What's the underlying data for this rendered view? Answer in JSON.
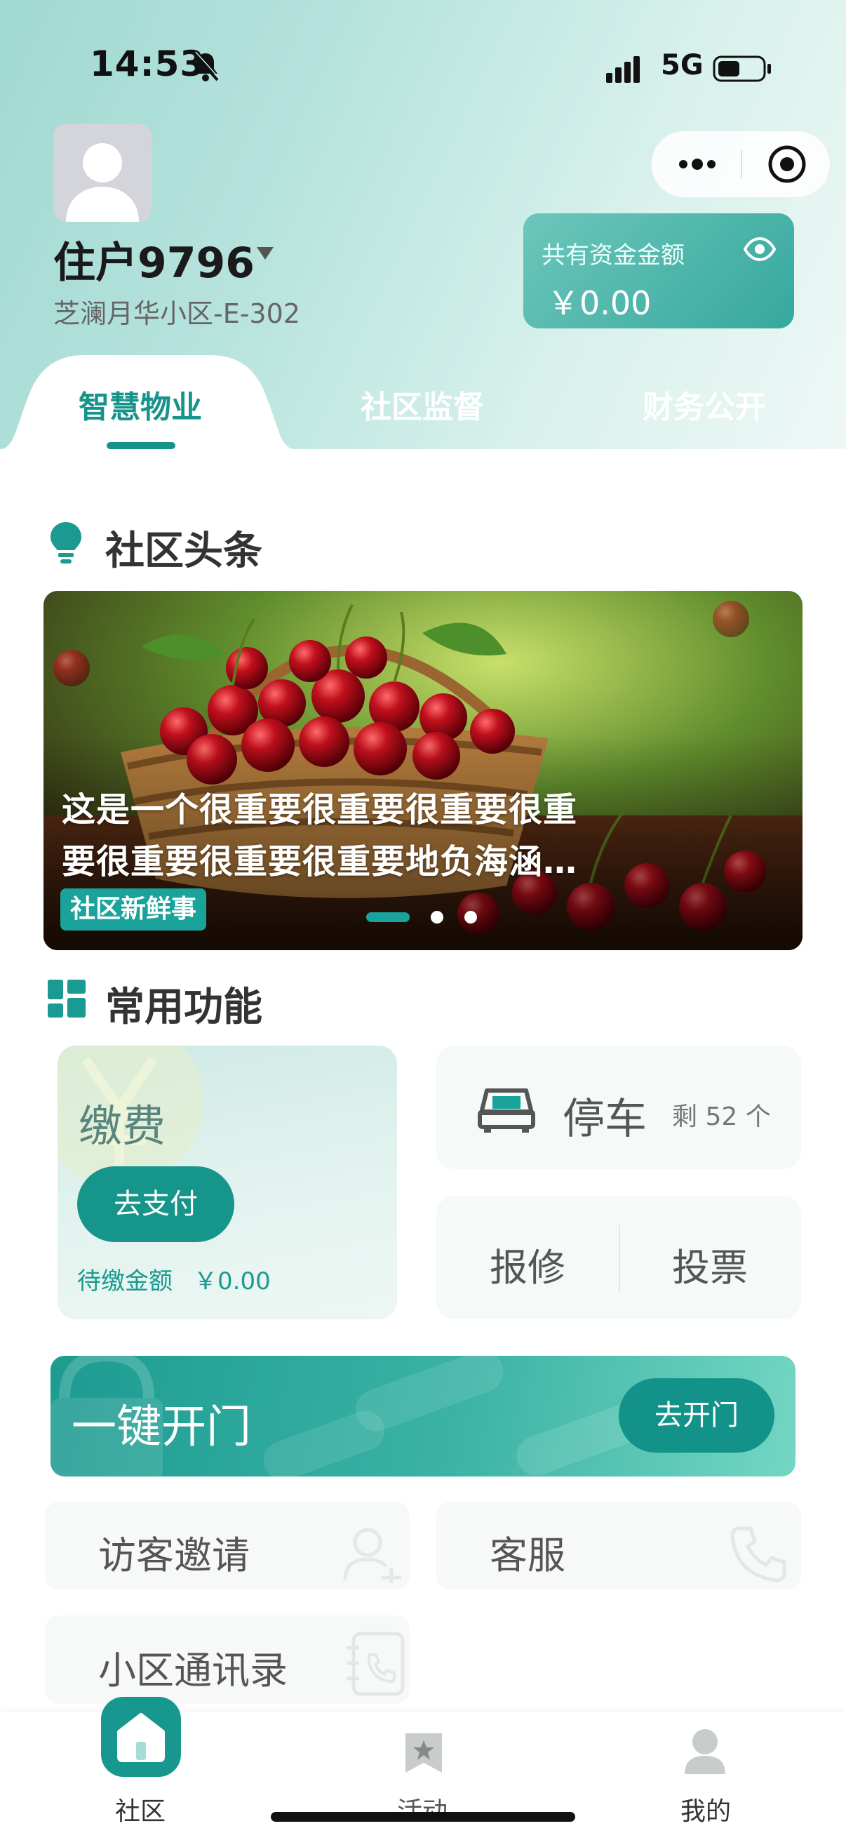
{
  "status_bar": {
    "time": "14:53",
    "network": "5G"
  },
  "user": {
    "name": "住户9796",
    "address": "芝澜月华小区-E-302"
  },
  "fund": {
    "label": "共有资金金额",
    "amount": "￥0.00"
  },
  "tabs": [
    {
      "label": "智慧物业",
      "active": true
    },
    {
      "label": "社区监督",
      "active": false
    },
    {
      "label": "财务公开",
      "active": false
    }
  ],
  "news": {
    "section_title": "社区头条",
    "headline_line1": "这是一个很重要很重要很重要很重",
    "headline_line2": "要很重要很重要很重要地负海涵…",
    "badge": "社区新鲜事",
    "slide_count": 3,
    "active_slide": 1
  },
  "functions": {
    "section_title": "常用功能",
    "payment": {
      "title": "缴费",
      "button": "去支付",
      "due_label": "待缴金额",
      "due_amount": "￥0.00"
    },
    "parking": {
      "title": "停车",
      "remaining": "剩 52 个"
    },
    "repair": "报修",
    "vote": "投票",
    "open_door": {
      "title": "一键开门",
      "button": "去开门"
    },
    "visitor": "访客邀请",
    "service": "客服",
    "directory": "小区通讯录"
  },
  "bottom_nav": [
    {
      "label": "社区",
      "icon": "home-icon",
      "active": true
    },
    {
      "label": "活动",
      "icon": "star-bookmark-icon",
      "active": false
    },
    {
      "label": "我的",
      "icon": "person-icon",
      "active": false
    }
  ],
  "colors": {
    "accent": "#16938a",
    "header_start": "#9fd9d1",
    "fund_card": "#36a89e"
  }
}
